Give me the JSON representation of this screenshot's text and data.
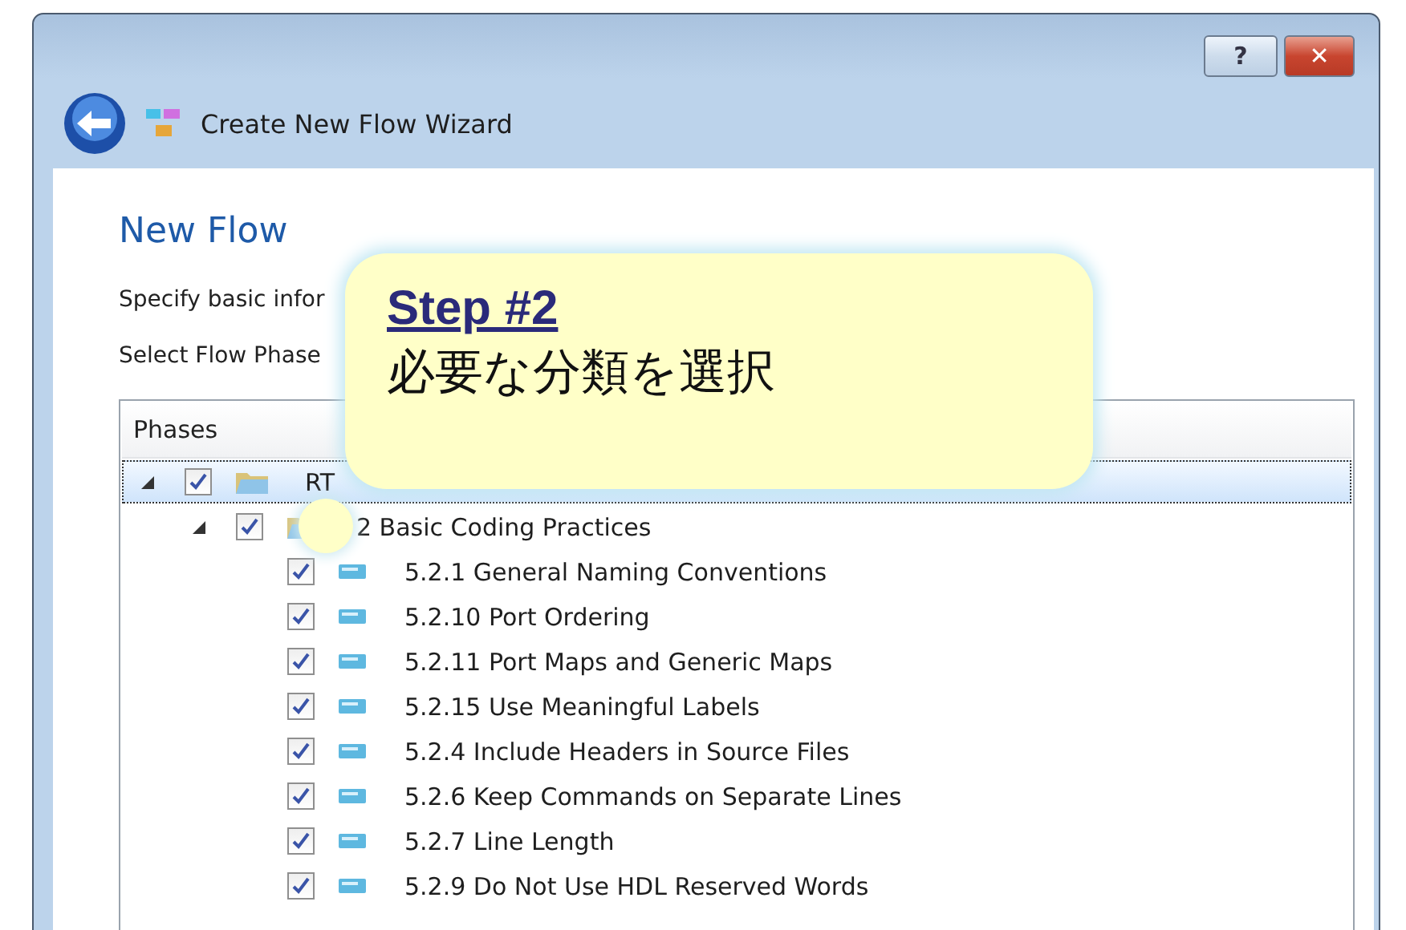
{
  "window": {
    "title": "Create New Flow Wizard",
    "buttons": [
      {
        "kind": "help",
        "label": "?"
      },
      {
        "kind": "close",
        "label": "✕"
      }
    ]
  },
  "page": {
    "heading": "New Flow",
    "description": "Specify basic infor",
    "phases_label": "Select Flow Phase"
  },
  "tree": {
    "header": "Phases",
    "items": [
      {
        "label": "RT",
        "checked": true,
        "expanded": true,
        "selected": true,
        "kind": "folder",
        "children": [
          {
            "label": "2 Basic Coding Practices",
            "checked": true,
            "expanded": true,
            "selected": false,
            "kind": "folder",
            "children": [
              {
                "label": "5.2.1 General Naming Conventions",
                "checked": true,
                "selected": false,
                "kind": "rule"
              },
              {
                "label": "5.2.10 Port Ordering",
                "checked": true,
                "selected": false,
                "kind": "rule"
              },
              {
                "label": "5.2.11 Port Maps and Generic Maps",
                "checked": true,
                "selected": false,
                "kind": "rule"
              },
              {
                "label": "5.2.15 Use Meaningful Labels",
                "checked": true,
                "selected": false,
                "kind": "rule"
              },
              {
                "label": "5.2.4 Include Headers in Source Files",
                "checked": true,
                "selected": false,
                "kind": "rule"
              },
              {
                "label": "5.2.6 Keep Commands on Separate Lines",
                "checked": true,
                "selected": false,
                "kind": "rule"
              },
              {
                "label": "5.2.7 Line Length",
                "checked": true,
                "selected": false,
                "kind": "rule"
              },
              {
                "label": "5.2.9 Do Not Use HDL Reserved Words",
                "checked": true,
                "selected": false,
                "kind": "rule"
              }
            ]
          }
        ]
      }
    ]
  },
  "callout": {
    "title": "Step #2",
    "text": "必要な分類を選択"
  }
}
